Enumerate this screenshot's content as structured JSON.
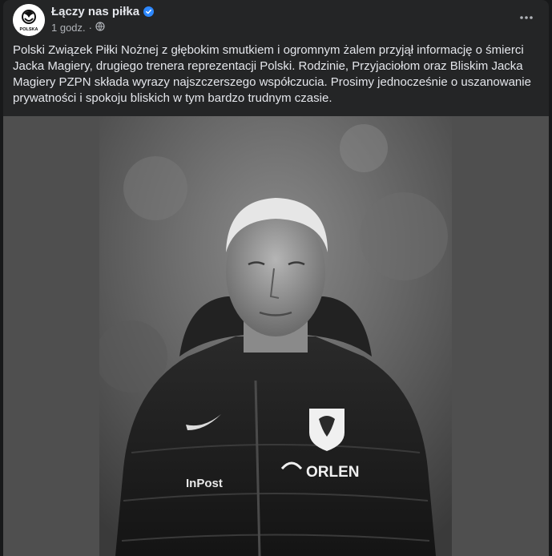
{
  "post": {
    "page_name": "Łączy nas piłka",
    "timestamp": "1 godz.",
    "separator": "·",
    "audience_icon": "globe-icon",
    "verified_icon": "verified-badge-icon",
    "more_icon": "more-options-icon",
    "avatar_text": "POLSKA",
    "text": "Polski Związek Piłki Nożnej z głębokim smutkiem i ogromnym żalem przyjął informację o śmierci Jacka Magiery, drugiego trenera reprezentacji Polski. Rodzinie, Przyjaciołom oraz Bliskim Jacka Magiery PZPN składa wyrazy najszczerszego współczucia. Prosimy jednocześnie o uszanowanie prywatności i spokoju bliskich w tym bardzo trudnym czasie."
  },
  "photo": {
    "jacket_brand_1": "InPost",
    "jacket_brand_2": "ORLEN",
    "colors": {
      "side_panel": "#4f4f4f",
      "jacket": "#1c1c1c"
    }
  },
  "colors": {
    "background": "#18191a",
    "card": "#242526",
    "primary_text": "#e4e6eb",
    "secondary_text": "#b0b3b8",
    "verified": "#2d88ff"
  }
}
